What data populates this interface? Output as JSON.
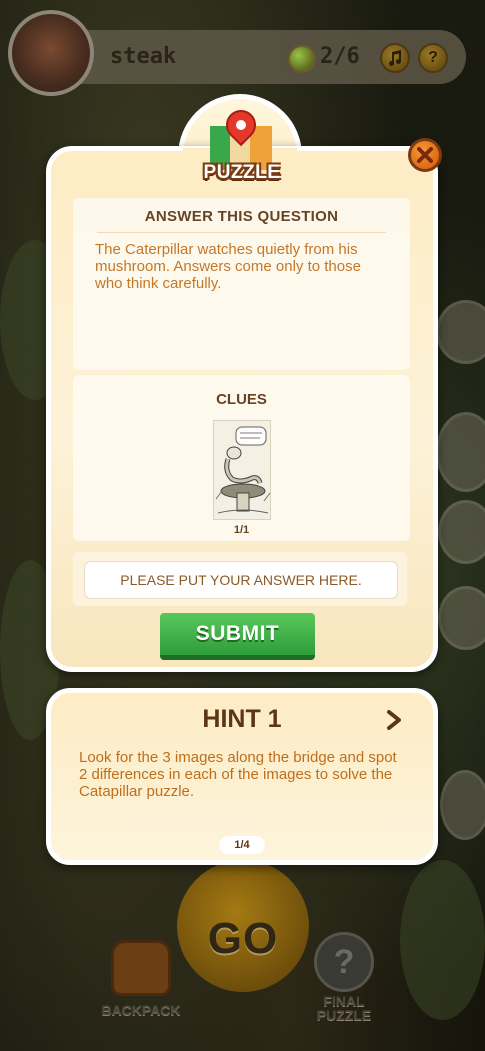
{
  "topbar": {
    "title": "steak",
    "progress": "2/6",
    "music_icon": "music-note-icon",
    "help_icon": "question-mark-icon",
    "help_symbol": "?"
  },
  "puzzle": {
    "title": "PUZZLE",
    "close_icon": "close-icon",
    "question": {
      "heading": "ANSWER THIS QUESTION",
      "text": "The Caterpillar watches quietly from his mushroom. Answers come only to those who think carefully."
    },
    "clues": {
      "heading": "CLUES",
      "counter": "1/1"
    },
    "answer": {
      "placeholder": "PLEASE PUT YOUR ANSWER HERE.",
      "value": ""
    },
    "submit_label": "SUBMIT"
  },
  "hint": {
    "title": "HINT 1",
    "text": "Look for the 3 images along the bridge and spot 2 differences in each of the images to solve the Catapillar puzzle.",
    "pager": "1/4",
    "next_icon": "chevron-right-icon"
  },
  "bottom": {
    "go_label": "GO",
    "backpack_label": "BACKPACK",
    "final_label_line1": "FINAL",
    "final_label_line2": "PUZZLE",
    "final_symbol": "?"
  },
  "colors": {
    "accent_orange": "#c06e1c",
    "heading_brown": "#5a3616",
    "submit_green": "#3fae45",
    "close_orange": "#e87c22"
  }
}
